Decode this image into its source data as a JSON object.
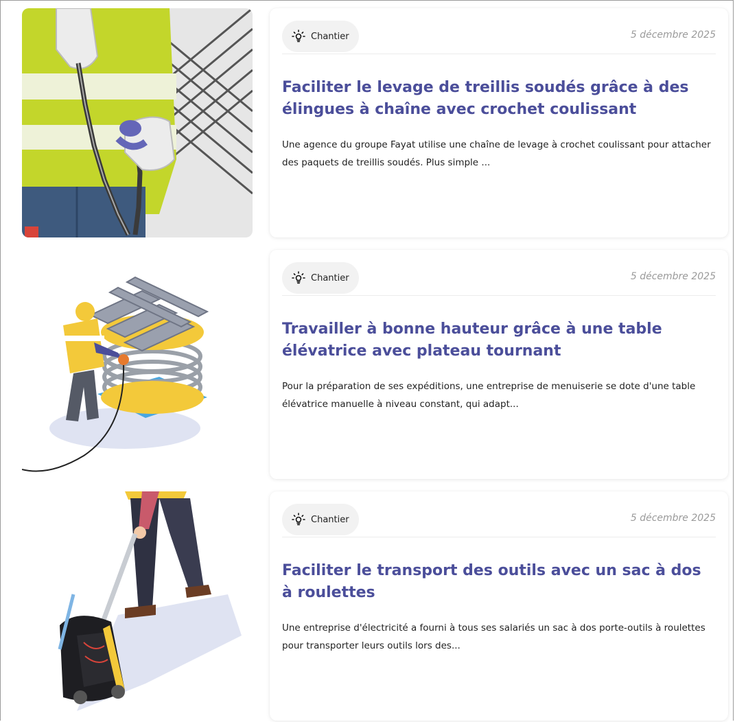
{
  "articles": [
    {
      "tag": "Chantier",
      "tag_icon": "lightbulb-icon",
      "date": "5 décembre 2025",
      "title": "Faciliter le levage de treillis soudés grâce à des élingues à chaîne avec crochet coulissant",
      "excerpt": "Une agence du groupe Fayat utilise une chaîne de levage à crochet coulissant pour attacher des paquets de treillis soudés. Plus simple ..."
    },
    {
      "tag": "Chantier",
      "tag_icon": "lightbulb-icon",
      "date": "5 décembre 2025",
      "title": "Travailler à bonne hauteur grâce à une table élévatrice avec plateau tournant",
      "excerpt": "Pour la préparation de ses expéditions, une entreprise de menuiserie se dote d'une table élévatrice manuelle à niveau constant, qui adapt..."
    },
    {
      "tag": "Chantier",
      "tag_icon": "lightbulb-icon",
      "date": "5 décembre 2025",
      "title": "Faciliter le transport des outils avec un sac à dos à roulettes",
      "excerpt": "Une entreprise d'électricité a fourni à tous ses salariés un sac à dos porte-outils à roulettes pour transporter leurs outils lors des..."
    }
  ],
  "colors": {
    "title": "#4b4e9a",
    "vest_yellow": "#c3d62b",
    "accent_purple": "#6466b8"
  }
}
